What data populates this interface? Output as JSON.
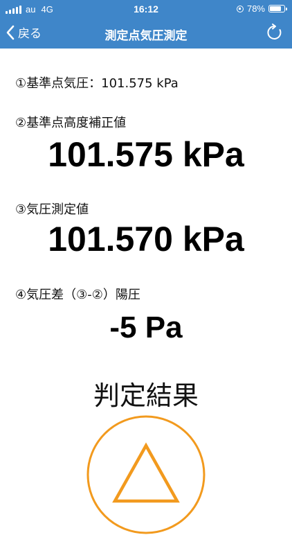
{
  "status_bar": {
    "carrier": "au",
    "network": "4G",
    "time": "16:12",
    "battery_percent": "78%",
    "battery_level": 0.78
  },
  "nav": {
    "back_label": "戻る",
    "title": "測定点気圧測定"
  },
  "readings": {
    "ref_pressure_line": "①基準点気圧：101.575 kPa",
    "corrected_label": "②基準点高度補正値",
    "corrected_value": "101.575 kPa",
    "measured_label": "③気圧測定値",
    "measured_value": "101.570 kPa",
    "diff_label": "④気圧差（③-②）陽圧",
    "diff_value": "-5 Pa"
  },
  "result": {
    "title": "判定結果",
    "symbol": "triangle-icon",
    "color": "#f29a1e"
  },
  "colors": {
    "header": "#3f86c9",
    "result_accent": "#f29a1e"
  }
}
